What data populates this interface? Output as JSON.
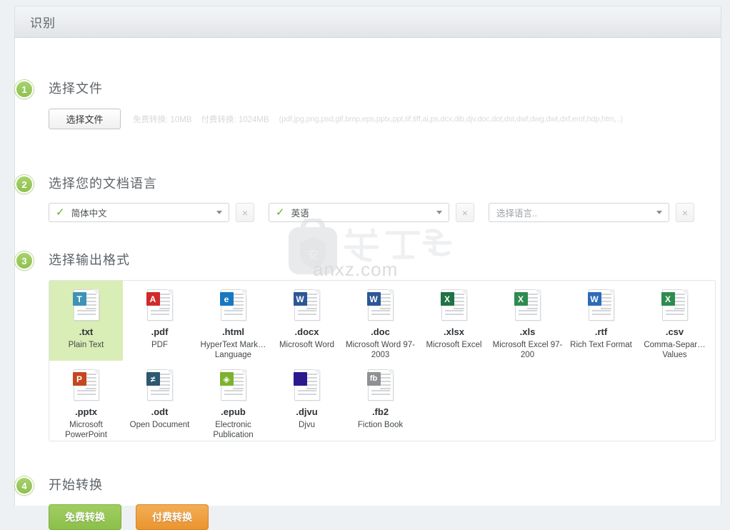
{
  "panel": {
    "title": "识别"
  },
  "steps": [
    {
      "number": "1",
      "title": "选择文件"
    },
    {
      "number": "2",
      "title": "选择您的文档语言"
    },
    {
      "number": "3",
      "title": "选择输出格式"
    },
    {
      "number": "4",
      "title": "开始转换"
    }
  ],
  "file_section": {
    "choose_file_label": "选择文件",
    "free_limit": "免费转换: 10MB",
    "paid_limit": "付费转换: 1024MB",
    "formats_hint": "(pdf,jpg,png,psd,gif,bmp,eps,pptx,ppt,tif,tiff,ai,ps,dcx,dib,djv,doc,dot,dst,dwf,dwg,dwt,dxf,emf,hdp,htm,..)"
  },
  "language_section": {
    "selects": [
      {
        "value": "简体中文",
        "has_check": true,
        "is_placeholder": false,
        "clear_label": "×"
      },
      {
        "value": "英语",
        "has_check": true,
        "is_placeholder": false,
        "clear_label": "×"
      },
      {
        "value": "选择语言..",
        "has_check": false,
        "is_placeholder": true,
        "clear_label": "×"
      }
    ]
  },
  "format_section": {
    "rows": [
      [
        {
          "ext": ".txt",
          "name": "Plain Text",
          "selected": true,
          "icon": "txt-file-icon",
          "badge": "T",
          "color": "#3d93b5"
        },
        {
          "ext": ".pdf",
          "name": "PDF",
          "selected": false,
          "icon": "pdf-file-icon",
          "badge": "A",
          "color": "#d02b2b"
        },
        {
          "ext": ".html",
          "name": "HyperText Mark… Language",
          "selected": false,
          "icon": "html-file-icon",
          "badge": "e",
          "color": "#1877c0"
        },
        {
          "ext": ".docx",
          "name": "Microsoft Word",
          "selected": false,
          "icon": "docx-file-icon",
          "badge": "W",
          "color": "#2b5797"
        },
        {
          "ext": ".doc",
          "name": "Microsoft Word 97-2003",
          "selected": false,
          "icon": "doc-file-icon",
          "badge": "W",
          "color": "#2b5797"
        },
        {
          "ext": ".xlsx",
          "name": "Microsoft Excel",
          "selected": false,
          "icon": "xlsx-file-icon",
          "badge": "X",
          "color": "#1f7244"
        },
        {
          "ext": ".xls",
          "name": "Microsoft Excel 97-200",
          "selected": false,
          "icon": "xls-file-icon",
          "badge": "X",
          "color": "#2e8b50"
        },
        {
          "ext": ".rtf",
          "name": "Rich Text Format",
          "selected": false,
          "icon": "rtf-file-icon",
          "badge": "W",
          "color": "#2b6cb8"
        },
        {
          "ext": ".csv",
          "name": "Comma-Separ… Values",
          "selected": false,
          "icon": "csv-file-icon",
          "badge": "X",
          "color": "#2e8b50"
        }
      ],
      [
        {
          "ext": ".pptx",
          "name": "Microsoft PowerPoint",
          "selected": false,
          "icon": "pptx-file-icon",
          "badge": "P",
          "color": "#c4471f"
        },
        {
          "ext": ".odt",
          "name": "Open Document",
          "selected": false,
          "icon": "odt-file-icon",
          "badge": "≠",
          "color": "#2c5871"
        },
        {
          "ext": ".epub",
          "name": "Electronic Publication",
          "selected": false,
          "icon": "epub-file-icon",
          "badge": "◈",
          "color": "#7cb22e"
        },
        {
          "ext": ".djvu",
          "name": "Djvu",
          "selected": false,
          "icon": "djvu-file-icon",
          "badge": "",
          "color": "#2b1a8e"
        },
        {
          "ext": ".fb2",
          "name": "Fiction Book",
          "selected": false,
          "icon": "fb2-file-icon",
          "badge": "fb",
          "color": "#8d9194"
        }
      ]
    ]
  },
  "convert_section": {
    "free_button": "免费转换",
    "paid_button": "付费转换"
  },
  "watermark": {
    "logo_text": "安",
    "brand_text": "安下载",
    "site_text": "anxz.com"
  }
}
